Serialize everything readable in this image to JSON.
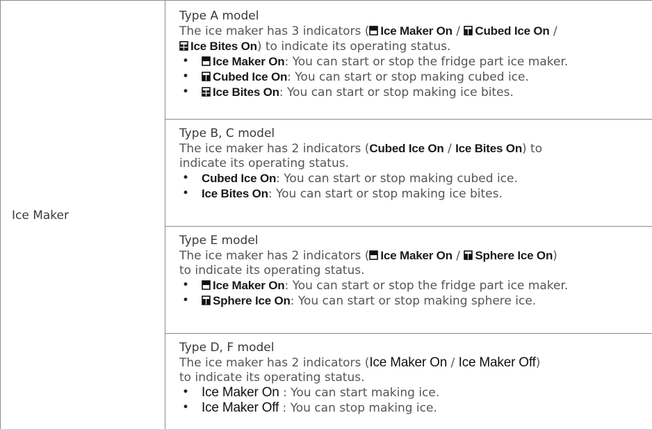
{
  "row_label": "Ice Maker",
  "sections": [
    {
      "title": "Type A model",
      "desc_pre": "The ice maker has 3 indicators (",
      "ind1": "Ice Maker On",
      "sep1": " / ",
      "ind2": "Cubed Ice On",
      "sep2": " /",
      "ind3": "Ice Bites On",
      "desc_post": ") to indicate its operating status.",
      "bullets": [
        {
          "indicator": "Ice Maker On",
          "text": ": You can start or stop the fridge part ice maker."
        },
        {
          "indicator": "Cubed Ice On",
          "text": ": You can start or stop making cubed ice."
        },
        {
          "indicator": "Ice Bites On",
          "text": ": You can start or stop making ice bites."
        }
      ]
    },
    {
      "title": "Type B, C model",
      "desc_pre": "The ice maker has 2 indicators (",
      "ind1": "Cubed Ice On",
      "sep1": " / ",
      "ind2": "Ice Bites On",
      "desc_post1": ") to",
      "desc_line2": "indicate its operating status.",
      "bullets": [
        {
          "indicator": "Cubed Ice On",
          "text": ": You can start or stop making cubed ice."
        },
        {
          "indicator": "Ice Bites On",
          "text": ": You can start or stop making ice bites."
        }
      ]
    },
    {
      "title": "Type E model",
      "desc_pre": "The ice maker has 2 indicators (",
      "ind1": "Ice Maker On",
      "sep1": " / ",
      "ind2": "Sphere Ice On",
      "desc_post1": ")",
      "desc_line2": "to indicate its operating status.",
      "bullets": [
        {
          "indicator": "Ice Maker On",
          "text": ": You can start or stop the fridge part ice maker."
        },
        {
          "indicator": "Sphere Ice On",
          "text": ": You can start or stop making sphere ice."
        }
      ]
    },
    {
      "title": "Type D, F model",
      "desc_pre": "The ice maker has 2 indicators (",
      "ind1": "Ice Maker On",
      "sep1": " / ",
      "ind2": "Ice Maker Off",
      "desc_post1": ")",
      "desc_line2": "to indicate its operating status.",
      "bullets": [
        {
          "indicator": "Ice Maker On",
          "text": " : You can start making ice."
        },
        {
          "indicator": "Ice Maker Off",
          "text": " : You can stop making ice."
        }
      ]
    }
  ],
  "icons": {
    "ice_maker": "ice-maker-icon",
    "cubed_ice": "cubed-ice-icon",
    "ice_bites": "ice-bites-icon",
    "sphere_ice": "sphere-ice-icon"
  }
}
